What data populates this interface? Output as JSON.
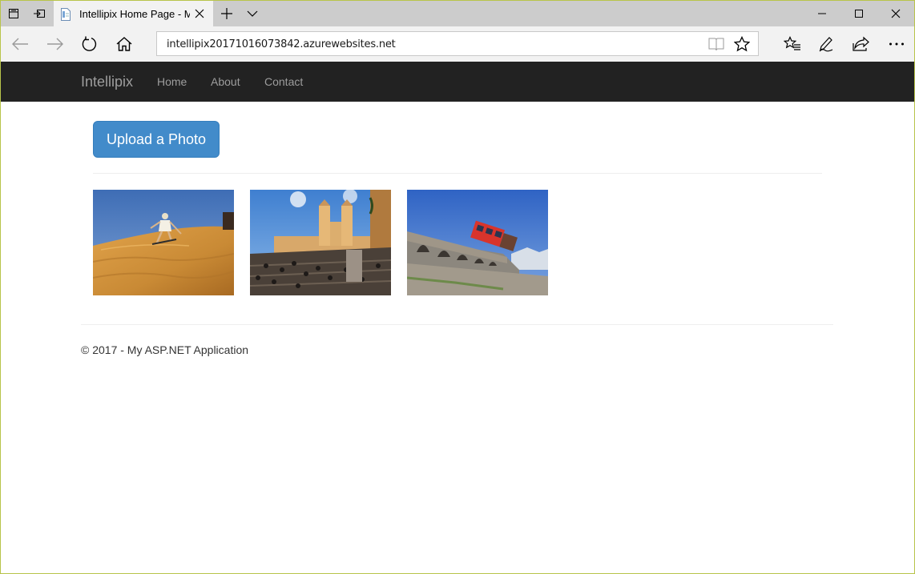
{
  "browser": {
    "tab_title": "Intellipix Home Page - M",
    "address": "intellipix20171016073842.azurewebsites.net",
    "icons": [
      "tab-set-aside-icon",
      "tabs-preview-icon",
      "page-icon",
      "close-icon",
      "new-tab-icon",
      "chevron-down-icon",
      "minimize-icon",
      "maximize-icon",
      "close-window-icon",
      "back-icon",
      "forward-icon",
      "refresh-icon",
      "home-icon",
      "reading-view-icon",
      "favorite-star-icon",
      "favorites-hub-icon",
      "web-note-icon",
      "share-icon",
      "more-icon"
    ]
  },
  "site": {
    "brand": "Intellipix",
    "nav": {
      "home": "Home",
      "about": "About",
      "contact": "Contact"
    },
    "upload_label": "Upload a Photo",
    "photos": [
      "desert sandboarding photo",
      "Spanish Steps church photo",
      "red funicular train photo"
    ],
    "footer": "© 2017 - My ASP.NET Application"
  },
  "colors": {
    "navbar": "#222222",
    "button": "#428bca",
    "chrome": "#cccccc"
  }
}
